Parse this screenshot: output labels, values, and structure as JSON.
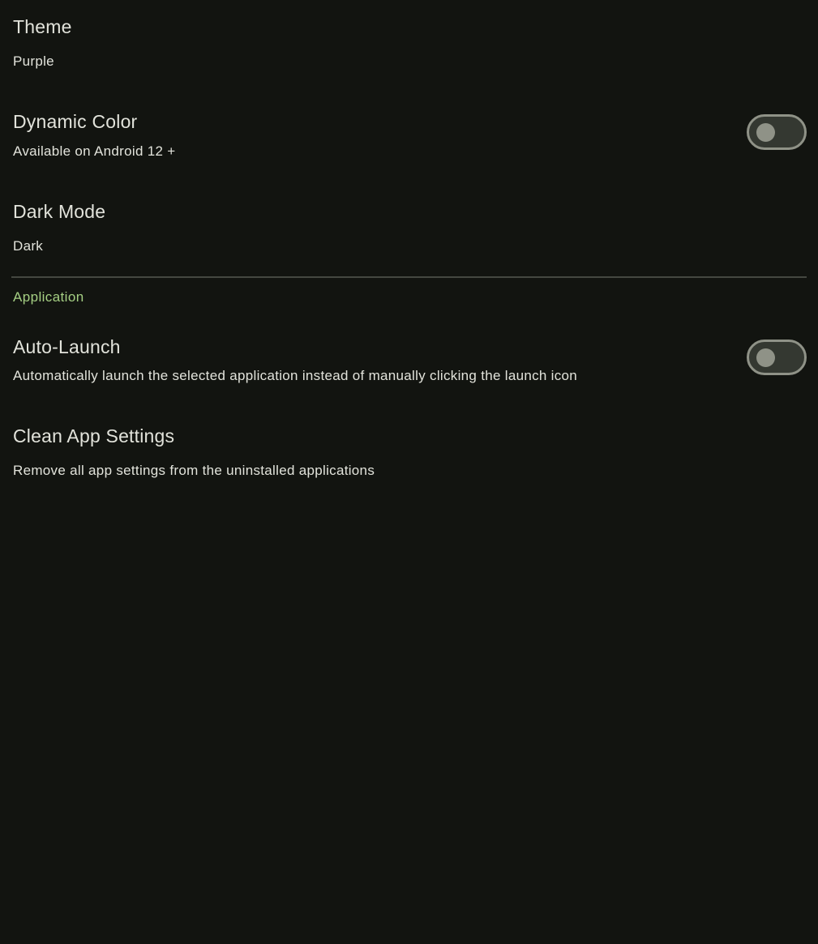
{
  "settings": {
    "theme": {
      "title": "Theme",
      "value": "Purple"
    },
    "dynamic_color": {
      "title": "Dynamic Color",
      "subtitle": "Available on Android 12 +",
      "enabled": false
    },
    "dark_mode": {
      "title": "Dark Mode",
      "value": "Dark"
    },
    "application_section": "Application",
    "auto_launch": {
      "title": "Auto-Launch",
      "subtitle": "Automatically launch the selected application instead of manually clicking the launch icon",
      "enabled": false
    },
    "clean_app_settings": {
      "title": "Clean App Settings",
      "subtitle": "Remove all app settings from the uninstalled applications"
    }
  },
  "colors": {
    "background": "#121410",
    "accent": "#a5cf83",
    "text": "#e2e3db"
  }
}
